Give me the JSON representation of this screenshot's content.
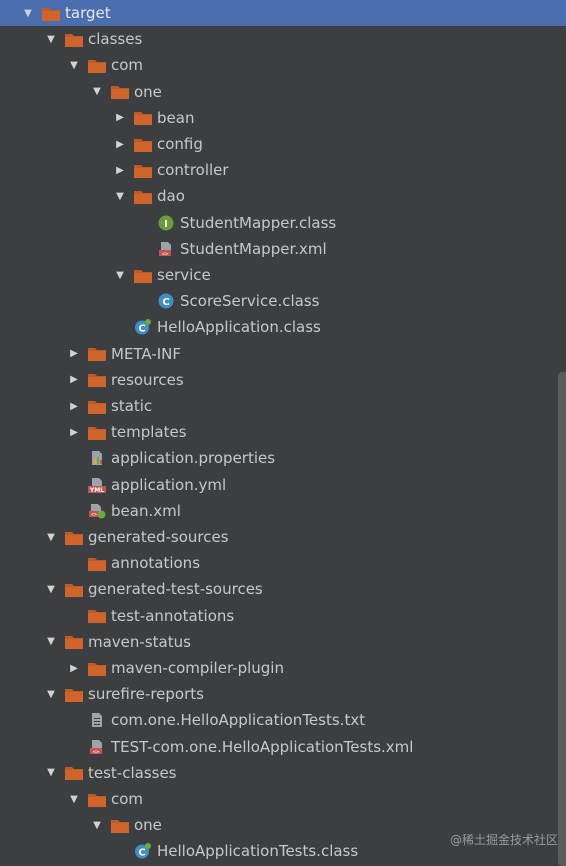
{
  "colors": {
    "selection": "#4b6eaf",
    "folder": "#c05b26",
    "background": "#3c3f41"
  },
  "tree": [
    {
      "label": "target",
      "depth": 0,
      "arrow": "open",
      "icon": "folder",
      "selected": true
    },
    {
      "label": "classes",
      "depth": 1,
      "arrow": "open",
      "icon": "folder"
    },
    {
      "label": "com",
      "depth": 2,
      "arrow": "open",
      "icon": "folder"
    },
    {
      "label": "one",
      "depth": 3,
      "arrow": "open",
      "icon": "folder"
    },
    {
      "label": "bean",
      "depth": 4,
      "arrow": "closed",
      "icon": "folder"
    },
    {
      "label": "config",
      "depth": 4,
      "arrow": "closed",
      "icon": "folder"
    },
    {
      "label": "controller",
      "depth": 4,
      "arrow": "closed",
      "icon": "folder"
    },
    {
      "label": "dao",
      "depth": 4,
      "arrow": "open",
      "icon": "folder"
    },
    {
      "label": "StudentMapper.class",
      "depth": 5,
      "arrow": "none",
      "icon": "interface-icon"
    },
    {
      "label": "StudentMapper.xml",
      "depth": 5,
      "arrow": "none",
      "icon": "xml-file-icon"
    },
    {
      "label": "service",
      "depth": 4,
      "arrow": "open",
      "icon": "folder"
    },
    {
      "label": "ScoreService.class",
      "depth": 5,
      "arrow": "none",
      "icon": "class-icon"
    },
    {
      "label": "HelloApplication.class",
      "depth": 4,
      "arrow": "none",
      "icon": "spring-class-icon"
    },
    {
      "label": "META-INF",
      "depth": 2,
      "arrow": "closed",
      "icon": "folder"
    },
    {
      "label": "resources",
      "depth": 2,
      "arrow": "closed",
      "icon": "folder"
    },
    {
      "label": "static",
      "depth": 2,
      "arrow": "closed",
      "icon": "folder"
    },
    {
      "label": "templates",
      "depth": 2,
      "arrow": "closed",
      "icon": "folder"
    },
    {
      "label": "application.properties",
      "depth": 2,
      "arrow": "none",
      "icon": "properties-file-icon"
    },
    {
      "label": "application.yml",
      "depth": 2,
      "arrow": "none",
      "icon": "yml-file-icon"
    },
    {
      "label": "bean.xml",
      "depth": 2,
      "arrow": "none",
      "icon": "spring-xml-icon"
    },
    {
      "label": "generated-sources",
      "depth": 1,
      "arrow": "open",
      "icon": "folder"
    },
    {
      "label": "annotations",
      "depth": 2,
      "arrow": "none",
      "icon": "folder"
    },
    {
      "label": "generated-test-sources",
      "depth": 1,
      "arrow": "open",
      "icon": "folder"
    },
    {
      "label": "test-annotations",
      "depth": 2,
      "arrow": "none",
      "icon": "folder"
    },
    {
      "label": "maven-status",
      "depth": 1,
      "arrow": "open",
      "icon": "folder"
    },
    {
      "label": "maven-compiler-plugin",
      "depth": 2,
      "arrow": "closed",
      "icon": "folder"
    },
    {
      "label": "surefire-reports",
      "depth": 1,
      "arrow": "open",
      "icon": "folder"
    },
    {
      "label": "com.one.HelloApplicationTests.txt",
      "depth": 2,
      "arrow": "none",
      "icon": "text-file-icon"
    },
    {
      "label": "TEST-com.one.HelloApplicationTests.xml",
      "depth": 2,
      "arrow": "none",
      "icon": "xml-file-icon"
    },
    {
      "label": "test-classes",
      "depth": 1,
      "arrow": "open",
      "icon": "folder"
    },
    {
      "label": "com",
      "depth": 2,
      "arrow": "open",
      "icon": "folder"
    },
    {
      "label": "one",
      "depth": 3,
      "arrow": "open",
      "icon": "folder"
    },
    {
      "label": "HelloApplicationTests.class",
      "depth": 4,
      "arrow": "none",
      "icon": "spring-class-icon"
    }
  ],
  "watermark": "@稀土掘金技术社区"
}
